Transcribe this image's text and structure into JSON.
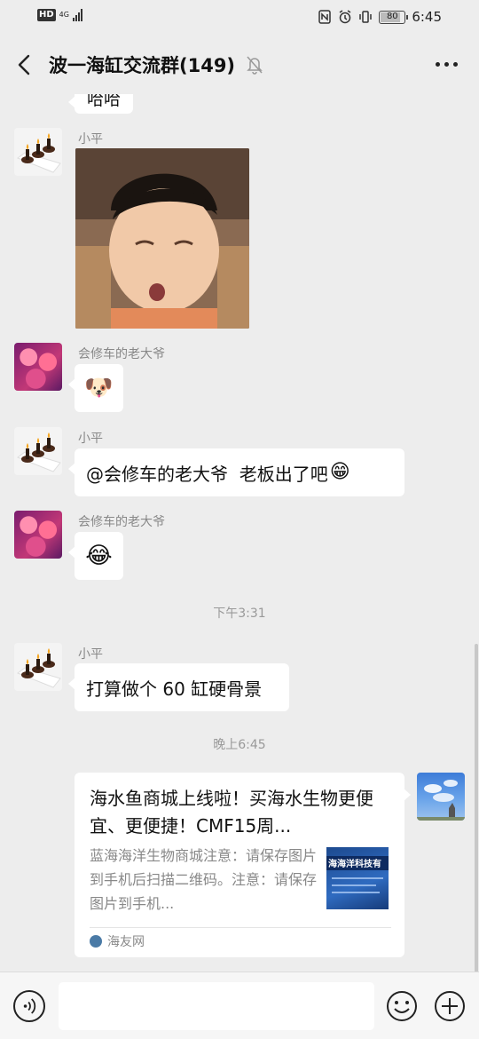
{
  "status_bar": {
    "hd": "HD",
    "network": "4G",
    "battery": "80",
    "time": "6:45"
  },
  "header": {
    "title": "波一海缸交流群(149)"
  },
  "messages": [
    {
      "sender": "",
      "text": "哈哈",
      "partial": true
    },
    {
      "sender": "小平",
      "type": "image"
    },
    {
      "sender": "会修车的老大爷",
      "type": "emoji",
      "emoji": "🐶"
    },
    {
      "sender": "小平",
      "text": "@会修车的老大爷  老板出了吧",
      "emoji": "😁"
    },
    {
      "sender": "会修车的老大爷",
      "type": "emoji",
      "emoji": "😂"
    },
    {
      "timestamp": "下午3:31"
    },
    {
      "sender": "小平",
      "text": "打算做个 60 缸硬骨景"
    },
    {
      "timestamp": "晚上6:45"
    },
    {
      "sender": "me",
      "type": "link_card",
      "title": "海水鱼商城上线啦！买海水生物更便宜、更便捷！CMF15周...",
      "description": "蓝海海洋生物商城注意：请保存图片到手机后扫描二维码。注意：请保存图片到手机...",
      "thumb_text": "海海洋科技有",
      "source": "海友网"
    }
  ],
  "colors": {
    "background": "#ededed",
    "bubble": "#ffffff",
    "meta_text": "#888888"
  },
  "icons": [
    "back-arrow-icon",
    "mute-icon",
    "more-icon",
    "voice-icon",
    "emoji-icon",
    "plus-icon"
  ]
}
